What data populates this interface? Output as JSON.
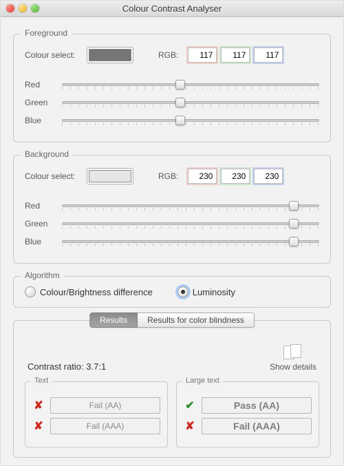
{
  "window": {
    "title": "Colour Contrast Analyser"
  },
  "foreground": {
    "legend": "Foreground",
    "colour_select_label": "Colour select:",
    "rgb_label": "RGB:",
    "swatch_hex": "#757575",
    "r": "117",
    "g": "117",
    "b": "117",
    "sliders": {
      "red": {
        "label": "Red",
        "value": 117,
        "max": 255
      },
      "green": {
        "label": "Green",
        "value": 117,
        "max": 255
      },
      "blue": {
        "label": "Blue",
        "value": 117,
        "max": 255
      }
    }
  },
  "background": {
    "legend": "Background",
    "colour_select_label": "Colour select:",
    "rgb_label": "RGB:",
    "swatch_hex": "#e6e6e6",
    "r": "230",
    "g": "230",
    "b": "230",
    "sliders": {
      "red": {
        "label": "Red",
        "value": 230,
        "max": 255
      },
      "green": {
        "label": "Green",
        "value": 230,
        "max": 255
      },
      "blue": {
        "label": "Blue",
        "value": 230,
        "max": 255
      }
    }
  },
  "algorithm": {
    "legend": "Algorithm",
    "options": {
      "brightness": {
        "label": "Colour/Brightness difference",
        "selected": false
      },
      "luminosity": {
        "label": "Luminosity",
        "selected": true
      }
    }
  },
  "results": {
    "tabs": {
      "results": "Results",
      "blindness": "Results for color blindness"
    },
    "contrast_label": "Contrast ratio: 3.7:1",
    "show_details": "Show details",
    "text": {
      "legend": "Text",
      "aa": {
        "label": "Fail (AA)",
        "pass": false
      },
      "aaa": {
        "label": "Fail (AAA)",
        "pass": false
      }
    },
    "large_text": {
      "legend": "Large text",
      "aa": {
        "label": "Pass (AA)",
        "pass": true
      },
      "aaa": {
        "label": "Fail (AAA)",
        "pass": false
      }
    }
  }
}
